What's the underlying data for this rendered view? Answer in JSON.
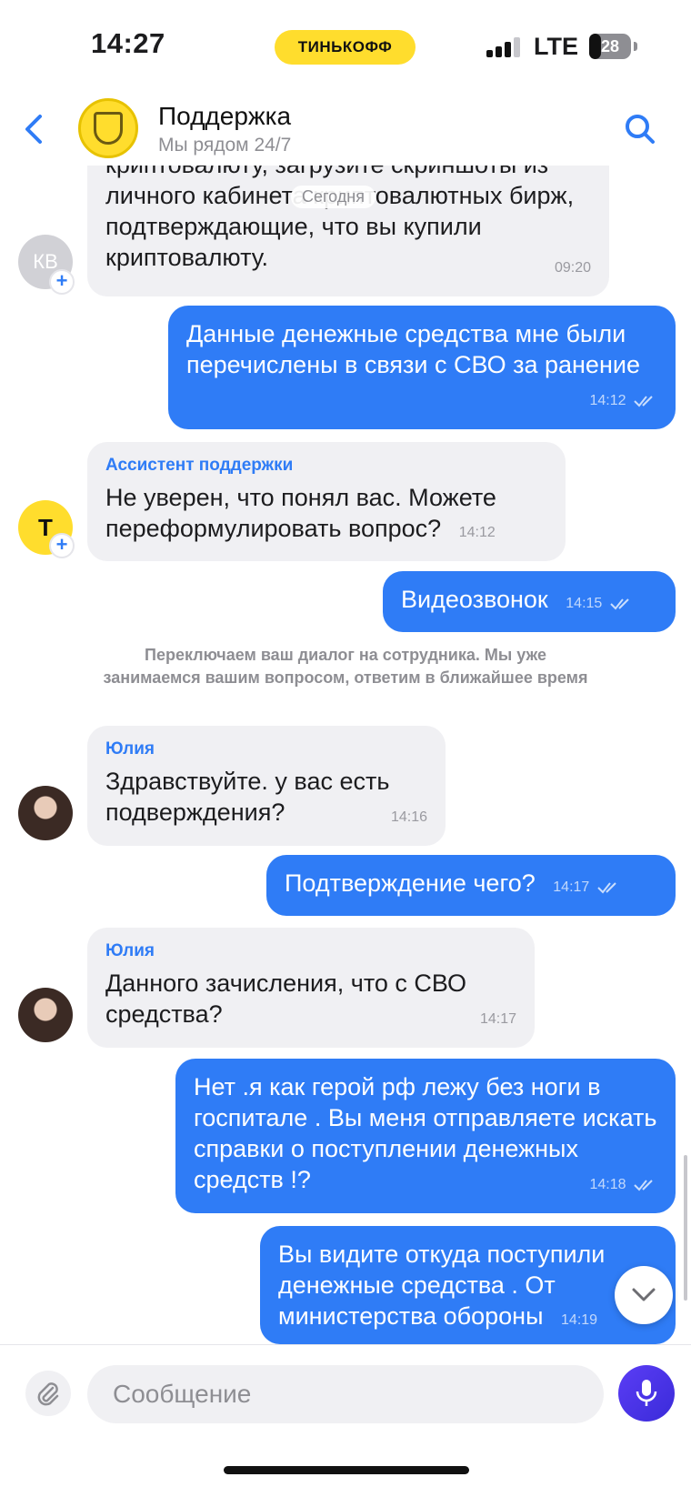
{
  "status_bar": {
    "time": "14:27",
    "carrier_pill": "ТИНЬКОФФ",
    "network": "LTE",
    "battery": "28",
    "battery_level": 0.28
  },
  "header": {
    "title": "Поддержка",
    "subtitle": "Мы рядом 24/7"
  },
  "chat": {
    "date_chip": "Сегодня",
    "system_note": "Переключаем ваш диалог на сотрудника. Мы уже занимаемся вашим вопросом, ответим в ближайшее время",
    "avatar_initials": "КВ",
    "avatar_t": "Т",
    "messages": [
      {
        "text": "криптовалюту, загрузите скриншоты из личного кабинета криптовалютных бирж, подтверждающие, что вы купили криптовалюту.",
        "time": "09:20",
        "sender": ""
      },
      {
        "text": "Данные денежные средства мне были перечислены в связи с СВО за ранение",
        "time": "14:12"
      },
      {
        "text": "Не уверен, что понял вас. Можете переформулировать вопрос?",
        "time": "14:12",
        "sender": "Ассистент поддержки"
      },
      {
        "text": "Видеозвонок",
        "time": "14:15"
      },
      {
        "text": "Здравствуйте. у вас есть подверждения?",
        "time": "14:16",
        "sender": "Юлия"
      },
      {
        "text": "Подтверждение чего?",
        "time": "14:17"
      },
      {
        "text": "Данного зачисления, что с СВО средства?",
        "time": "14:17",
        "sender": "Юлия"
      },
      {
        "text": "Нет .я как герой рф лежу без ноги в госпитале . Вы меня отправляете искать справки о поступлении денежных средств !?",
        "time": "14:18"
      },
      {
        "text": "Вы  видите откуда поступили денежные средства . От министерства обороны",
        "time": "14:19"
      }
    ]
  },
  "composer": {
    "placeholder": "Сообщение"
  },
  "colors": {
    "accent": "#2f7cf6",
    "brand_yellow": "#ffdd2d",
    "incoming_bg": "#f0f0f3",
    "mic": "#4a35e6"
  }
}
